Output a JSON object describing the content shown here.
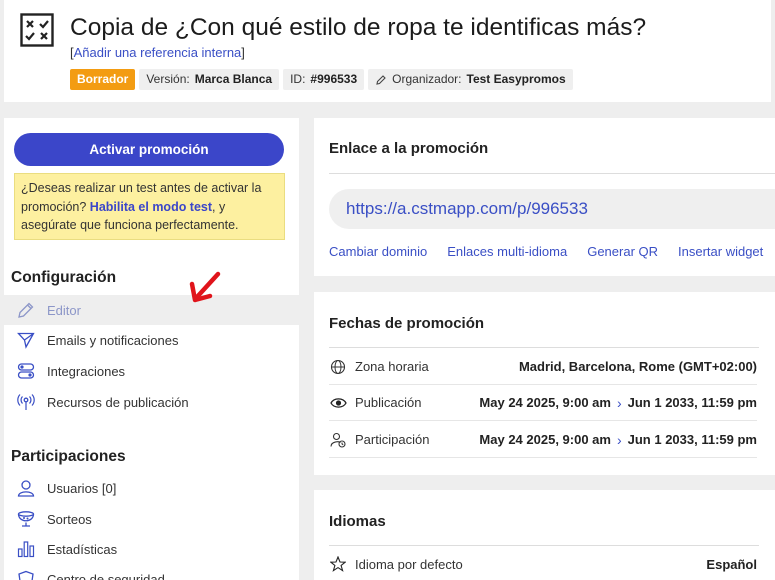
{
  "header": {
    "title": "Copia de ¿Con qué estilo de ropa te identificas más?",
    "reference_link": "Añadir una referencia interna",
    "badges": {
      "status": "Borrador",
      "version_label": "Versión:",
      "version_value": "Marca Blanca",
      "id_label": "ID:",
      "id_value": "#996533",
      "organizer_label": "Organizador:",
      "organizer_value": "Test Easypromos"
    }
  },
  "sidebar": {
    "activate_button": "Activar promoción",
    "notice": {
      "text_before": "¿Deseas realizar un test antes de activar la promoción? ",
      "link": "Habilita el modo test",
      "text_after": ", y asegúrate que funciona perfectamente."
    },
    "config_title": "Configuración",
    "config_items": [
      {
        "label": "Editor",
        "icon": "pencil-icon"
      },
      {
        "label": "Emails y notificaciones",
        "icon": "paper-plane-icon"
      },
      {
        "label": "Integraciones",
        "icon": "toggles-icon"
      },
      {
        "label": "Recursos de publicación",
        "icon": "broadcast-icon"
      }
    ],
    "participations_title": "Participaciones",
    "participation_items": [
      {
        "label": "Usuarios [0]",
        "icon": "user-icon"
      },
      {
        "label": "Sorteos",
        "icon": "draw-bowl-icon"
      },
      {
        "label": "Estadísticas",
        "icon": "bar-chart-icon"
      },
      {
        "label": "Centro de seguridad",
        "icon": "shield-icon"
      }
    ]
  },
  "promo_link": {
    "title": "Enlace a la promoción",
    "url": "https://a.cstmapp.com/p/996533",
    "actions": [
      "Cambiar dominio",
      "Enlaces multi-idioma",
      "Generar QR",
      "Insertar widget"
    ]
  },
  "dates": {
    "title": "Fechas de promoción",
    "rows": [
      {
        "label": "Zona horaria",
        "value": "Madrid, Barcelona, Rome (GMT+02:00)",
        "icon": "globe-icon"
      },
      {
        "label": "Publicación",
        "start": "May 24 2025, 9:00 am",
        "end": "Jun 1 2033, 11:59 pm",
        "icon": "eye-icon"
      },
      {
        "label": "Participación",
        "start": "May 24 2025, 9:00 am",
        "end": "Jun 1 2033, 11:59 pm",
        "icon": "user-clock-icon"
      }
    ]
  },
  "languages": {
    "title": "Idiomas",
    "rows": [
      {
        "label": "Idioma por defecto",
        "value": "Español",
        "icon": "star-icon"
      }
    ]
  },
  "colors": {
    "accent": "#3b46c9",
    "draft": "#f39c12",
    "notice_bg": "#fdf0a0",
    "link": "#3a4fc5",
    "arrow": "#e0141b"
  }
}
